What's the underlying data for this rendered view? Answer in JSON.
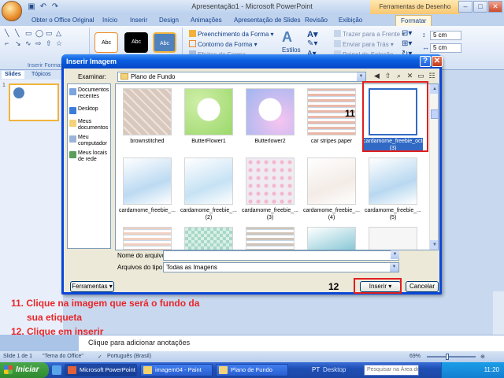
{
  "app": {
    "title": "Apresentação1 - Microsoft PowerPoint",
    "context_tools": "Ferramentas de Desenho",
    "tabs": [
      "Obter o Office Original",
      "Início",
      "Inserir",
      "Design",
      "Animações",
      "Apresentação de Slides",
      "Revisão",
      "Exibição",
      "Formatar"
    ],
    "window_controls": [
      "–",
      "□",
      "✕"
    ],
    "quick_access_icons": [
      "save-icon",
      "undo-icon",
      "redo-icon"
    ]
  },
  "ribbon": {
    "group_insert_shapes": "Inserir Formas",
    "style_samples": [
      "Abc",
      "Abc",
      "Abc"
    ],
    "fill": "Preenchimento da Forma",
    "outline": "Contorno da Forma",
    "effects": "Efeitos de Forma",
    "styles": "Estilos",
    "bring_front": "Trazer para a Frente",
    "send_back": "Enviar para Trás",
    "selection_pane": "Painel de Seleção",
    "height": "5 cm",
    "width": "5 cm"
  },
  "panes": {
    "tabs": [
      "Slides",
      "Tópicos"
    ],
    "slide_number": "1",
    "notes_placeholder": "Clique para adicionar anotações"
  },
  "status": {
    "slide": "Slide 1 de 1",
    "theme": "\"Tema do Office\"",
    "language": "Português (Brasil)",
    "zoom": "69%"
  },
  "taskbar": {
    "start": "Iniciar",
    "tasks": [
      "Microsoft PowerPoint ...",
      "imagem04 - Paint",
      "Plano de Fundo"
    ],
    "lang": "PT",
    "desktop": "Desktop",
    "search_placeholder": "Pesquisar na Área de ...",
    "time": "11:20"
  },
  "dialog": {
    "title": "Inserir Imagem",
    "look_in_label": "Examinar:",
    "look_in_value": "Plano de Fundo",
    "places": [
      "Documentos recentes",
      "Desktop",
      "Meus documentos",
      "Meu computador",
      "Meus locais de rede"
    ],
    "files": [
      {
        "name": "brownstitched",
        "color": "#d8c8bd",
        "pattern": "diag"
      },
      {
        "name": "ButterFlower1",
        "color": "#9bd86a",
        "pattern": "butterfly"
      },
      {
        "name": "Butterlower2",
        "color": "#9fb6f0",
        "pattern": "butterfly2"
      },
      {
        "name": "car stripes paper",
        "color": "#e9b8a8",
        "pattern": "stripes"
      },
      {
        "name": "cardamome_freebie_octobre_element (3)",
        "color": "#ffffff",
        "pattern": "plain",
        "selected": true
      },
      {
        "name": "cardamome_freebie_...",
        "color": "#bcdaf2",
        "pattern": "soft"
      },
      {
        "name": "cardamome_freebie_... (2)",
        "color": "#c6e2f4",
        "pattern": "soft"
      },
      {
        "name": "cardamome_freebie_... (3)",
        "color": "#f0eaf2",
        "pattern": "dots"
      },
      {
        "name": "cardamome_freebie_... (4)",
        "color": "#f3ebe6",
        "pattern": "soft"
      },
      {
        "name": "cardamome_freebie_... (5)",
        "color": "#b8d8f0",
        "pattern": "soft"
      },
      {
        "name": "",
        "color": "#f0d0c0",
        "pattern": "stripes"
      },
      {
        "name": "",
        "color": "#a8d8c8",
        "pattern": "check"
      },
      {
        "name": "",
        "color": "#cfc4b8",
        "pattern": "stripes"
      },
      {
        "name": "",
        "color": "#8ecad8",
        "pattern": "soft"
      },
      {
        "name": "",
        "color": "#f6f6f6",
        "pattern": "plain"
      }
    ],
    "filename_label": "Nome do arquivo:",
    "filename_value": "",
    "filetype_label": "Arquivos do tipo:",
    "filetype_value": "Todas as Imagens",
    "tools_button": "Ferramentas",
    "insert_button": "Inserir",
    "cancel_button": "Cancelar"
  },
  "annotations": {
    "marker_file": "11",
    "marker_insert": "12",
    "step11_line1": "11. Clique na imagem que será o fundo da",
    "step11_line2": "sua etiqueta",
    "step12": "12. Clique em inserir"
  }
}
